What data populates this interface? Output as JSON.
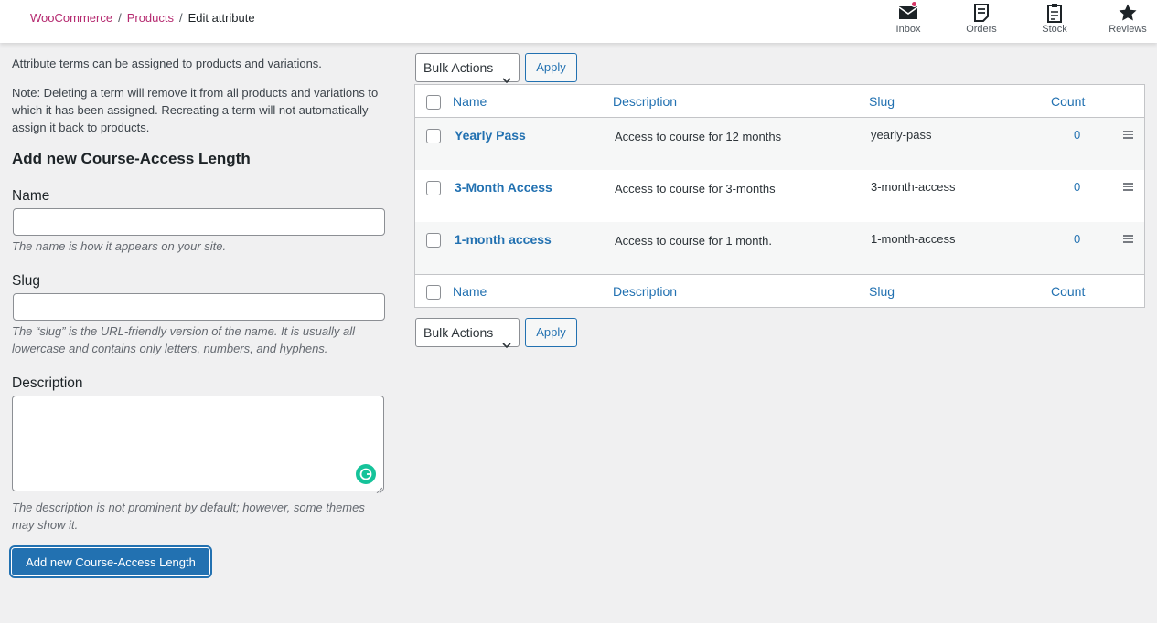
{
  "breadcrumb": {
    "items": [
      "WooCommerce",
      "Products"
    ],
    "separator": "/",
    "current": "Edit attribute"
  },
  "activity_bar": [
    {
      "label": "Inbox",
      "icon": "inbox-icon",
      "has_notification": true
    },
    {
      "label": "Orders",
      "icon": "orders-icon"
    },
    {
      "label": "Stock",
      "icon": "stock-icon"
    },
    {
      "label": "Reviews",
      "icon": "star-icon"
    }
  ],
  "intro": {
    "line1": "Attribute terms can be assigned to products and variations.",
    "line2": "Note: Deleting a term will remove it from all products and variations to which it has been assigned. Recreating a term will not automatically assign it back to products."
  },
  "form": {
    "heading": "Add new Course-Access Length",
    "name": {
      "label": "Name",
      "value": "",
      "help": "The name is how it appears on your site."
    },
    "slug": {
      "label": "Slug",
      "value": "",
      "help": "The “slug” is the URL-friendly version of the name. It is usually all lowercase and contains only letters, numbers, and hyphens."
    },
    "description": {
      "label": "Description",
      "value": "",
      "help": "The description is not prominent by default; however, some themes may show it."
    },
    "submit_label": "Add new Course-Access Length"
  },
  "bulk": {
    "label": "Bulk Actions",
    "apply_label": "Apply"
  },
  "table": {
    "columns": {
      "name": "Name",
      "description": "Description",
      "slug": "Slug",
      "count": "Count"
    },
    "rows": [
      {
        "name": "Yearly Pass",
        "description": "Access to course for 12 months",
        "slug": "yearly-pass",
        "count": "0"
      },
      {
        "name": "3-Month Access",
        "description": "Access to course for 3-months",
        "slug": "3-month-access",
        "count": "0"
      },
      {
        "name": "1-month access",
        "description": "Access to course for 1 month.",
        "slug": "1-month-access",
        "count": "0"
      }
    ]
  },
  "colors": {
    "accent": "#2271b1",
    "breadcrumb_link": "#b5296f",
    "notification": "#d63665",
    "grammarly": "#15c39a"
  }
}
